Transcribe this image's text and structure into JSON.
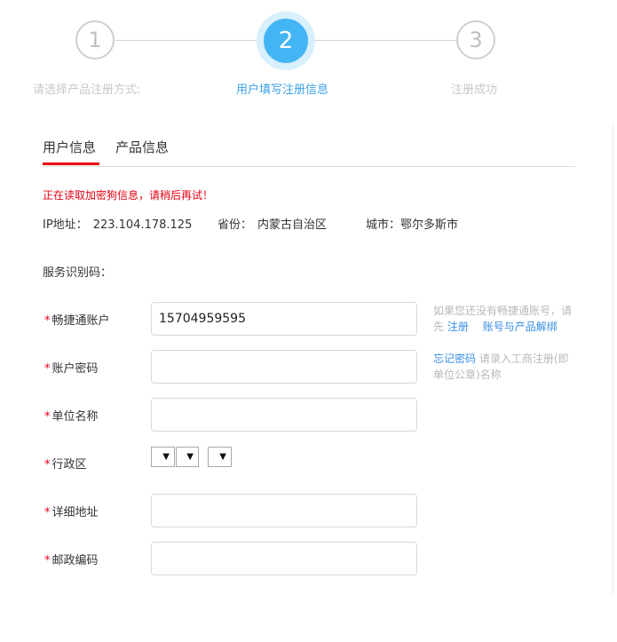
{
  "stepper": {
    "steps": [
      {
        "number": "1",
        "label": "请选择产品注册方式:"
      },
      {
        "number": "2",
        "label": "用户填写注册信息"
      },
      {
        "number": "3",
        "label": "注册成功"
      }
    ],
    "active_step": 2
  },
  "tabs": [
    {
      "label": "用户信息",
      "active": true
    },
    {
      "label": "产品信息",
      "active": false
    }
  ],
  "error_message": "正在读取加密狗信息，请稍后再试！",
  "location": {
    "ip_label": "IP地址：",
    "ip_value": "223.104.178.125",
    "province_label": "省份：",
    "province_value": "内蒙古自治区",
    "city_label": "城市：",
    "city_value": "鄂尔多斯市"
  },
  "service_code_label": "服务识别码：",
  "form": {
    "required_mark": "*",
    "account": {
      "label": "畅捷通账户",
      "value": "15704959595"
    },
    "password": {
      "label": "账户密码",
      "value": ""
    },
    "company": {
      "label": "单位名称",
      "value": ""
    },
    "region": {
      "label": "行政区",
      "selects": [
        "",
        "",
        ""
      ]
    },
    "address": {
      "label": "详细地址",
      "value": ""
    },
    "postcode": {
      "label": "邮政编码",
      "value": ""
    }
  },
  "hints": {
    "account_text": "如果您还没有畅捷通账号，请先",
    "register_link": "注册",
    "unbind_link": "账号与产品解绑",
    "forgot_link": "忘记密码",
    "password_text": "请录入工商注册(即单位公章)名称"
  },
  "colors": {
    "accent": "#44b5f4",
    "required": "#e60012",
    "link": "#3a8ee6"
  }
}
